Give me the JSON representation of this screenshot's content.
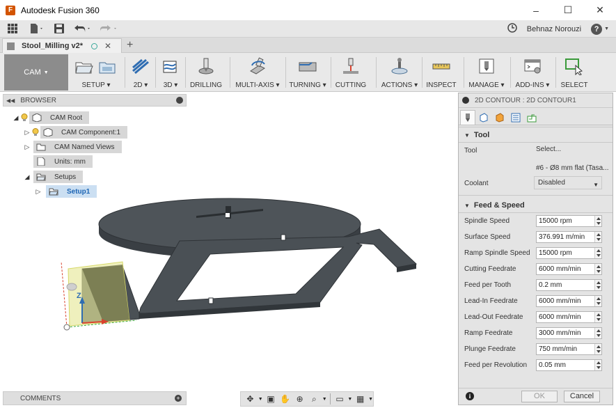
{
  "window": {
    "title": "Autodesk Fusion 360",
    "controls": [
      "–",
      "☐",
      "✕"
    ]
  },
  "qat": {
    "user": "Behnaz Norouzi"
  },
  "tab": {
    "label": "Stool_Milling v2*"
  },
  "ribbon": {
    "workspace": "CAM",
    "groups": [
      {
        "label": "SETUP ▾"
      },
      {
        "label": "2D ▾"
      },
      {
        "label": "3D ▾"
      },
      {
        "label": "DRILLING"
      },
      {
        "label": "MULTI-AXIS ▾"
      },
      {
        "label": "TURNING ▾"
      },
      {
        "label": "CUTTING"
      },
      {
        "label": "ACTIONS ▾"
      },
      {
        "label": "INSPECT"
      },
      {
        "label": "MANAGE ▾"
      },
      {
        "label": "ADD-INS ▾"
      },
      {
        "label": "SELECT"
      }
    ]
  },
  "browser": {
    "title": "BROWSER",
    "items": [
      {
        "label": "CAM Root"
      },
      {
        "label": "CAM Component:1"
      },
      {
        "label": "CAM Named Views"
      },
      {
        "label": "Units: mm"
      },
      {
        "label": "Setups"
      },
      {
        "label": "Setup1"
      }
    ]
  },
  "comments": {
    "label": "COMMENTS"
  },
  "dialog": {
    "title": "2D CONTOUR : 2D CONTOUR1",
    "tool_section": "Tool",
    "tool_label": "Tool",
    "tool_select": "Select...",
    "tool_desc": "#6 - Ø8 mm flat (Tasa...",
    "coolant_label": "Coolant",
    "coolant_value": "Disabled",
    "feed_section": "Feed & Speed",
    "fields": [
      {
        "label": "Spindle Speed",
        "value": "15000 rpm"
      },
      {
        "label": "Surface Speed",
        "value": "376.991 m/min"
      },
      {
        "label": "Ramp Spindle Speed",
        "value": "15000 rpm"
      },
      {
        "label": "Cutting Feedrate",
        "value": "6000 mm/min"
      },
      {
        "label": "Feed per Tooth",
        "value": "0.2 mm"
      },
      {
        "label": "Lead-In Feedrate",
        "value": "6000 mm/min"
      },
      {
        "label": "Lead-Out Feedrate",
        "value": "6000 mm/min"
      },
      {
        "label": "Ramp Feedrate",
        "value": "3000 mm/min"
      },
      {
        "label": "Plunge Feedrate",
        "value": "750 mm/min"
      },
      {
        "label": "Feed per Revolution",
        "value": "0.05 mm"
      }
    ],
    "ok": "OK",
    "cancel": "Cancel"
  },
  "viewcube": {
    "axis_label": "Z"
  },
  "colors": {
    "part": "#4a4f54",
    "stock_highlight": "#e6e89a",
    "accent": "#1e66b5"
  }
}
